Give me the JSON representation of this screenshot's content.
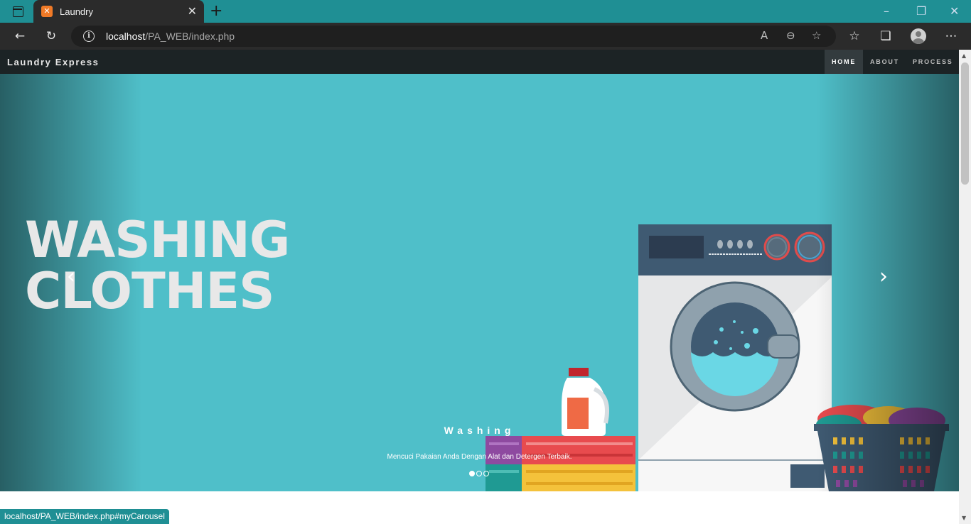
{
  "browser": {
    "tab": {
      "title": "Laundry",
      "favicon": "xampp-icon"
    },
    "address": {
      "host": "localhost",
      "path": "/PA_WEB/index.php"
    },
    "status_url": "localhost/PA_WEB/index.php#myCarousel",
    "accent": "#1f8f94"
  },
  "site": {
    "brand": "Laundry Express",
    "nav": [
      {
        "label": "HOME",
        "active": true
      },
      {
        "label": "ABOUT",
        "active": false
      },
      {
        "label": "PROCESS",
        "active": false
      }
    ]
  },
  "carousel": {
    "headline_line1": "WASHING",
    "headline_line2": "CLOTHES",
    "caption_title": "Washing",
    "caption_text": "Mencuci Pakaian Anda Dengan Alat dan Detergen Terbaik.",
    "slide_count": 3,
    "active_slide": 1,
    "background": "#4fbfc9"
  }
}
